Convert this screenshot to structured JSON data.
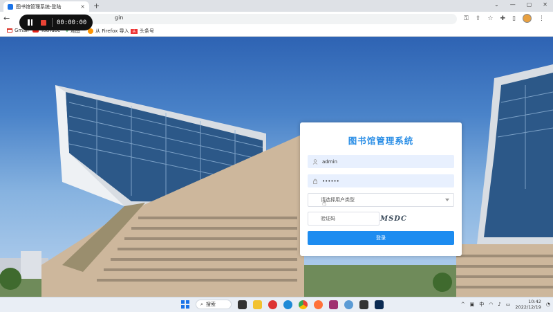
{
  "browser": {
    "tab_title": "图书馆管理系统-登陆",
    "tab_close": "×",
    "new_tab": "+",
    "window_controls": [
      "⌄",
      "—",
      "▢",
      "✕"
    ],
    "url_visible": "gin",
    "bookmarks": [
      {
        "label": "Gmail",
        "icon": "gmail-icon"
      },
      {
        "label": "YouTube",
        "icon": "youtube-icon"
      },
      {
        "label": "地图",
        "icon": "maps-icon"
      },
      {
        "label": "从 Firefox 导入",
        "icon": "folder-icon"
      },
      {
        "label": "头条号",
        "icon": "toutiao-icon"
      }
    ]
  },
  "recorder": {
    "elapsed": "00:00:00"
  },
  "login": {
    "title": "图书馆管理系统",
    "username": "admin",
    "password": "••••••",
    "user_type_placeholder": "请选择用户类型",
    "captcha_placeholder": "验证码",
    "captcha_image_text": "MSDC",
    "submit_label": "登录"
  },
  "taskbar": {
    "search_label": "搜索",
    "ime": "中",
    "time": "10:42",
    "date": "2022/12/19"
  },
  "colors": {
    "accent": "#1d8cf0",
    "title": "#2a8ee6",
    "input_fill": "#e8f0fe"
  }
}
